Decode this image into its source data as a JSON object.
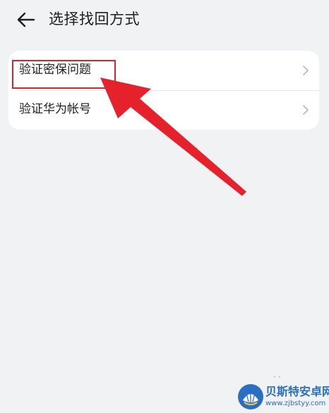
{
  "header": {
    "back_icon": "arrow-left-icon",
    "title": "选择找回方式"
  },
  "options": [
    {
      "label": "验证密保问题",
      "icon": "chevron-right-icon"
    },
    {
      "label": "验证华为帐号",
      "icon": "chevron-right-icon"
    }
  ],
  "annotation": {
    "color": "#e0202a"
  },
  "watermark": {
    "name": "贝斯特安卓网",
    "url": "www.zjbstyy.com"
  },
  "colors": {
    "background": "#f1f2f4",
    "card": "#ffffff",
    "text": "#1f1f1f",
    "chevron": "#b8b8bc",
    "watermark": "#2b6fc2"
  }
}
